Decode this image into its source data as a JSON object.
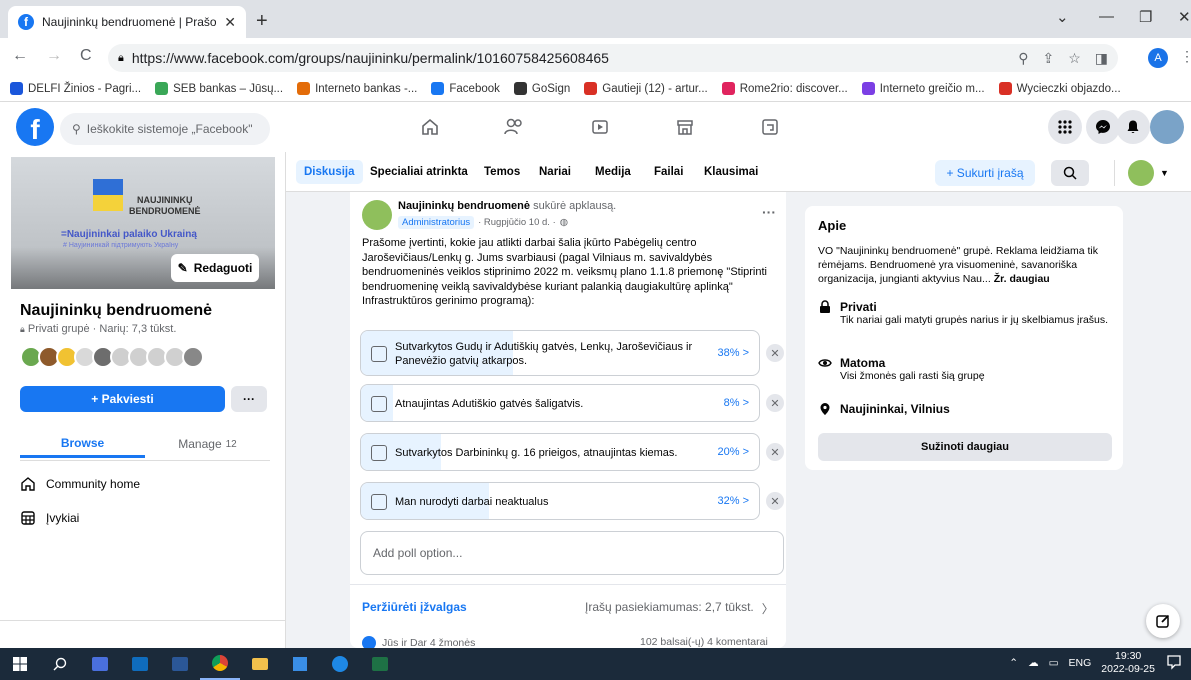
{
  "browser": {
    "tab_title": "Naujininkų bendruomenė | Prašo",
    "url": "https://www.facebook.com/groups/naujininku/permalink/10160758425608465",
    "profile_initial": "A",
    "bookmarks": [
      {
        "label": "DELFI Žinios - Pagri...",
        "color": "#1a56db"
      },
      {
        "label": "SEB bankas – Jūsų...",
        "color": "#3aa757"
      },
      {
        "label": "Interneto bankas -...",
        "color": "#e36c09"
      },
      {
        "label": "Facebook",
        "color": "#1877f2"
      },
      {
        "label": "GoSign",
        "color": "#333333"
      },
      {
        "label": "Gautieji (12) - artur...",
        "color": "#d93025"
      },
      {
        "label": "Rome2rio: discover...",
        "color": "#e0245e"
      },
      {
        "label": "Interneto greičio m...",
        "color": "#7b3fe4"
      },
      {
        "label": "Wycieczki objazdo...",
        "color": "#d93025"
      }
    ]
  },
  "fb": {
    "search_placeholder": "Ieškokite sistemoje „Facebook\""
  },
  "group": {
    "cover_title": "NAUJININKŲ\nBENDRUOMENĖ",
    "cover_sub": "=Naujininkai palaiko Ukrainą",
    "cover_sub2": "# Наујининкай підтримують Україну",
    "edit_label": "Redaguoti",
    "name": "Naujininkų bendruomenė",
    "meta": "Privati grupė · Narių: 7,3 tūkst.",
    "invite_label": "+ Pakviesti",
    "more_label": "···",
    "tab_browse": "Browse",
    "tab_manage": "Manage",
    "manage_count": "12",
    "menu": [
      "Community home",
      "Įvykiai"
    ]
  },
  "group_nav": {
    "tabs": [
      "Diskusija",
      "Specialiai atrinkta",
      "Temos",
      "Nariai",
      "Medija",
      "Failai",
      "Klausimai"
    ],
    "create_label": "+ Sukurti įrašą"
  },
  "post": {
    "author": "Naujininkų bendruomenė",
    "action": "sukūrė apklausą.",
    "role": "Administratorius",
    "date": "· Rugpjūčio 10 d. ·",
    "text": "Prašome įvertinti, kokie jau atlikti darbai šalia įkūrto Pabėgelių centro Jaroševičiaus/Lenkų g. Jums svarbiausi (pagal Vilniaus m. savivaldybės bendruomeninės veiklos stiprinimo 2022 m. veiksmų plano 1.1.8 priemonę \"Stiprinti bendruomeninę veiklą savivaldybėse kuriant palankią daugiakultūrę aplinką\" Infrastruktūros gerinimo programą):",
    "options": [
      {
        "label": "Sutvarkytos Gudų ir Adutiškių gatvės, Lenkų, Jaroševičiaus ir Panevėžio gatvių atkarpos.",
        "pct": "38% >",
        "share": 0.38
      },
      {
        "label": "Atnaujintas Adutiškio gatvės šaligatvis.",
        "pct": "8% >",
        "share": 0.08
      },
      {
        "label": "Sutvarkytos Darbininkų g. 16 prieigos, atnaujintas kiemas.",
        "pct": "20% >",
        "share": 0.2
      },
      {
        "label": "Man nurodyti darbai neaktualus",
        "pct": "32% >",
        "share": 0.32
      }
    ],
    "add_option_placeholder": "Add poll option...",
    "insights_label": "Peržiūrėti įžvalgas",
    "engagement": "Įrašų pasiekiamumas: 2,7 tūkst.",
    "reactions": "Jūs ir Dar 4 žmonės",
    "votes": "102 balsai(-ų)  4 komentarai"
  },
  "about": {
    "title": "Apie",
    "description": "VO \"Naujininkų bendruomenė\" grupė. Reklama leidžiama tik rėmėjams. Bendruomenė yra visuomeninė, savanoriška organizacija, jungianti aktyvius Nau...",
    "see_more": "Žr. daugiau",
    "private_title": "Privati",
    "private_desc": "Tik nariai gali matyti grupės narius ir jų skelbiamus įrašus.",
    "visible_title": "Matoma",
    "visible_desc": "Visi žmonės gali rasti šią grupę",
    "location": "Naujininkai, Vilnius",
    "learn_more": "Sužinoti daugiau"
  },
  "taskbar": {
    "lang": "ENG",
    "time": "19:30",
    "date": "2022-09-25"
  }
}
